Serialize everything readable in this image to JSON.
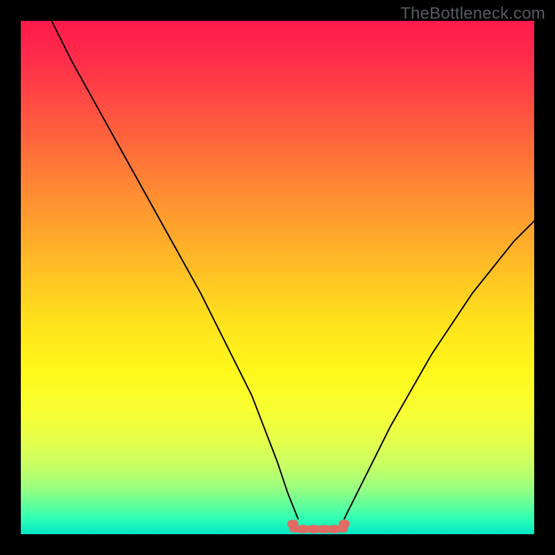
{
  "watermark": "TheBottleneck.com",
  "chart_data": {
    "type": "line",
    "title": "",
    "xlabel": "",
    "ylabel": "",
    "xlim": [
      0,
      100
    ],
    "ylim": [
      0,
      100
    ],
    "series": [
      {
        "name": "left-curve",
        "x": [
          6,
          10,
          15,
          20,
          25,
          30,
          35,
          40,
          45,
          50,
          52,
          54
        ],
        "values": [
          100,
          92,
          83,
          74,
          65,
          56,
          47,
          37,
          27,
          14,
          8,
          3
        ]
      },
      {
        "name": "right-curve",
        "x": [
          63,
          65,
          68,
          72,
          76,
          80,
          84,
          88,
          92,
          96,
          100
        ],
        "values": [
          3,
          7,
          13,
          21,
          28,
          35,
          41,
          47,
          52,
          57,
          61
        ]
      },
      {
        "name": "bottom-marks",
        "x": [
          53,
          55,
          57,
          59,
          61,
          63
        ],
        "values": [
          2,
          1,
          1,
          1,
          1,
          2
        ]
      }
    ],
    "annotations": [],
    "legend": false
  }
}
